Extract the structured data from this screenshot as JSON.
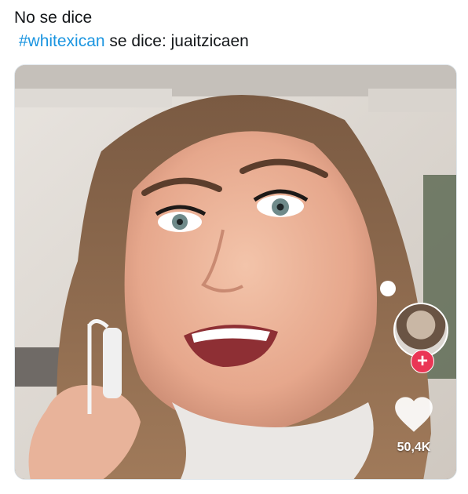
{
  "tweet": {
    "line1": "No se dice",
    "hashtag": "#whitexican",
    "line2_rest": " se dice: juaitzicaen"
  },
  "video": {
    "like_count": "50,4K",
    "follow_symbol": "+",
    "icons": {
      "like": "heart-icon",
      "follow": "plus-icon"
    },
    "colors": {
      "follow_badge": "#ea3655",
      "hashtag": "#1b95e0",
      "like_icon": "#ffffff"
    }
  }
}
